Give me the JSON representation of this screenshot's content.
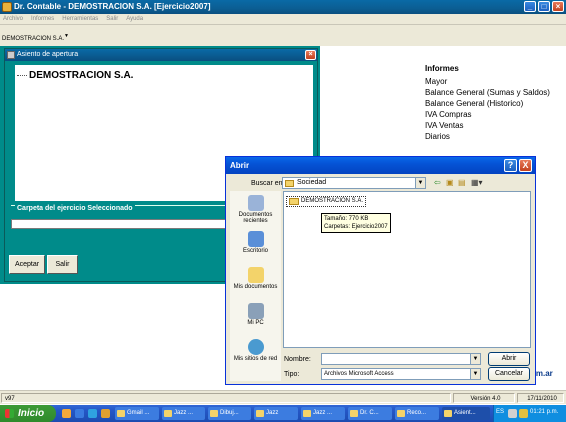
{
  "main_window": {
    "title": "Dr. Contable - DEMOSTRACION S.A.  [Ejercicio2007]",
    "menu": [
      "Archivo",
      "Informes",
      "Herramientas",
      "Salir",
      "Ayuda"
    ],
    "company_selector": "DEMOSTRACION S.A."
  },
  "asiento_dialog": {
    "title": "Asiento de apertura",
    "tree_node": "DEMOSTRACION S.A.",
    "group_label": "Carpeta del ejercicio Seleccionado",
    "accept_label": "Aceptar",
    "exit_label": "Salir"
  },
  "informes": {
    "heading": "Informes",
    "items": [
      "Mayor",
      "Balance General (Sumas y Saldos)",
      "Balance General (Historico)",
      "IVA Compras",
      "IVA Ventas",
      "Diarios"
    ]
  },
  "website_fragment": "om.ar",
  "statusbar": {
    "left": "v97",
    "version": "Versión 4.0",
    "date": "17/11/2010"
  },
  "open_dialog": {
    "title": "Abrir",
    "help_label": "?",
    "close_label": "X",
    "look_in_label": "Buscar en:",
    "look_in_value": "Sociedad",
    "places": [
      "Documentos recientes",
      "Escritorio",
      "Mis documentos",
      "Mi PC",
      "Mis sitios de red"
    ],
    "folder_item": "DEMOSTRACION S.A.",
    "tooltip_size": "Tamaño: 770 KB",
    "tooltip_folders": "Carpetas: Ejercicio2007",
    "name_label": "Nombre:",
    "name_value": "",
    "type_label": "Tipo:",
    "type_value": "Archivos Microsoft Access",
    "open_button": "Abrir",
    "cancel_button": "Cancelar"
  },
  "taskbar": {
    "start_label": "Inicio",
    "tasks": [
      "Gmail ...",
      "Jazz ...",
      "Dibuj...",
      "Jazz",
      "Jazz ...",
      "Dr. C...",
      "Reco...",
      "Asient..."
    ],
    "language": "ES",
    "clock": "01:21 p.m."
  },
  "colors": {
    "teal_background": "#008b8a",
    "xp_title_blue": "#0553d6",
    "taskbar_blue": "#2558c8",
    "start_green": "#3c9a36"
  }
}
